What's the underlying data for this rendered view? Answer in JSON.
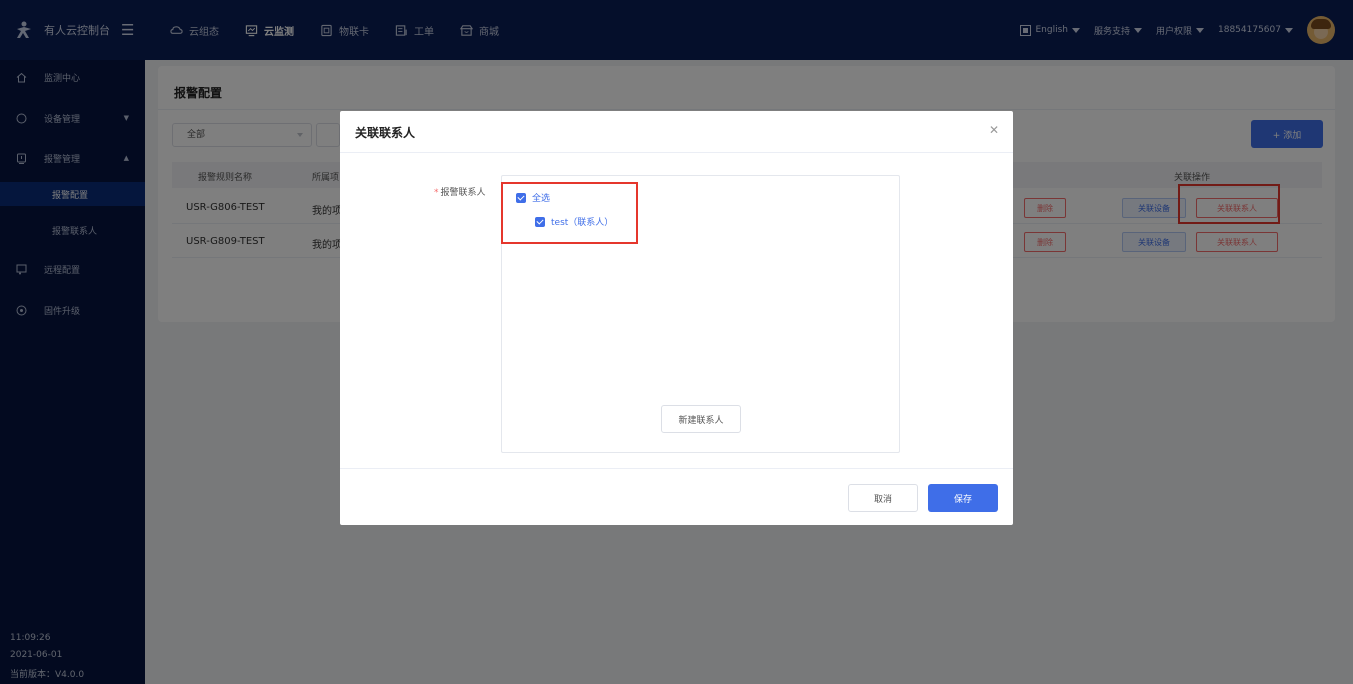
{
  "topbar": {
    "brand": "有人云控制台",
    "nav": [
      {
        "label": "云组态",
        "icon": "cloud-icon",
        "active": false
      },
      {
        "label": "云监测",
        "icon": "monitor-icon",
        "active": true
      },
      {
        "label": "物联卡",
        "icon": "sim-card-icon",
        "active": false
      },
      {
        "label": "工单",
        "icon": "ticket-icon",
        "active": false
      },
      {
        "label": "商城",
        "icon": "shop-icon",
        "active": false
      }
    ],
    "language": "English",
    "service": "服务支持",
    "permissions": "用户权限",
    "account": "18854175607"
  },
  "sidebar": {
    "items": [
      {
        "label": "监测中心",
        "icon": "home-icon"
      },
      {
        "label": "设备管理",
        "icon": "device-icon"
      },
      {
        "label": "报警管理",
        "icon": "alarm-icon"
      },
      {
        "label": "报警配置"
      },
      {
        "label": "报警联系人"
      },
      {
        "label": "远程配置",
        "icon": "remote-icon"
      },
      {
        "label": "固件升级",
        "icon": "upgrade-icon"
      }
    ],
    "footer": {
      "time": "11:09:26",
      "date": "2021-06-01",
      "version": "当前版本：V4.0.0"
    }
  },
  "card": {
    "title": "报警配置",
    "filter_value": "全部",
    "add_label": "+ 添加",
    "columns": {
      "name": "报警规则名称",
      "project": "所属项",
      "ops": "关联操作"
    },
    "rows": [
      {
        "name": "USR-G806-TEST",
        "project": "我的项",
        "delete": "删除",
        "link_device": "关联设备",
        "link_contact": "关联联系人"
      },
      {
        "name": "USR-G809-TEST",
        "project": "我的项",
        "delete": "删除",
        "link_device": "关联设备",
        "link_contact": "关联联系人"
      }
    ]
  },
  "modal": {
    "title": "关联联系人",
    "field_required": "*",
    "field_label": "报警联系人",
    "tree": {
      "select_all": "全选",
      "contacts": [
        {
          "label": "test（联系人）",
          "checked": true
        }
      ]
    },
    "new_contact": "新建联系人",
    "cancel": "取消",
    "save": "保存"
  },
  "colors": {
    "primary": "#3f6ee8",
    "danger": "#f56c6c",
    "highlight": "#e5362c",
    "topbar": "#0a1e57",
    "sidebar": "#061540"
  }
}
